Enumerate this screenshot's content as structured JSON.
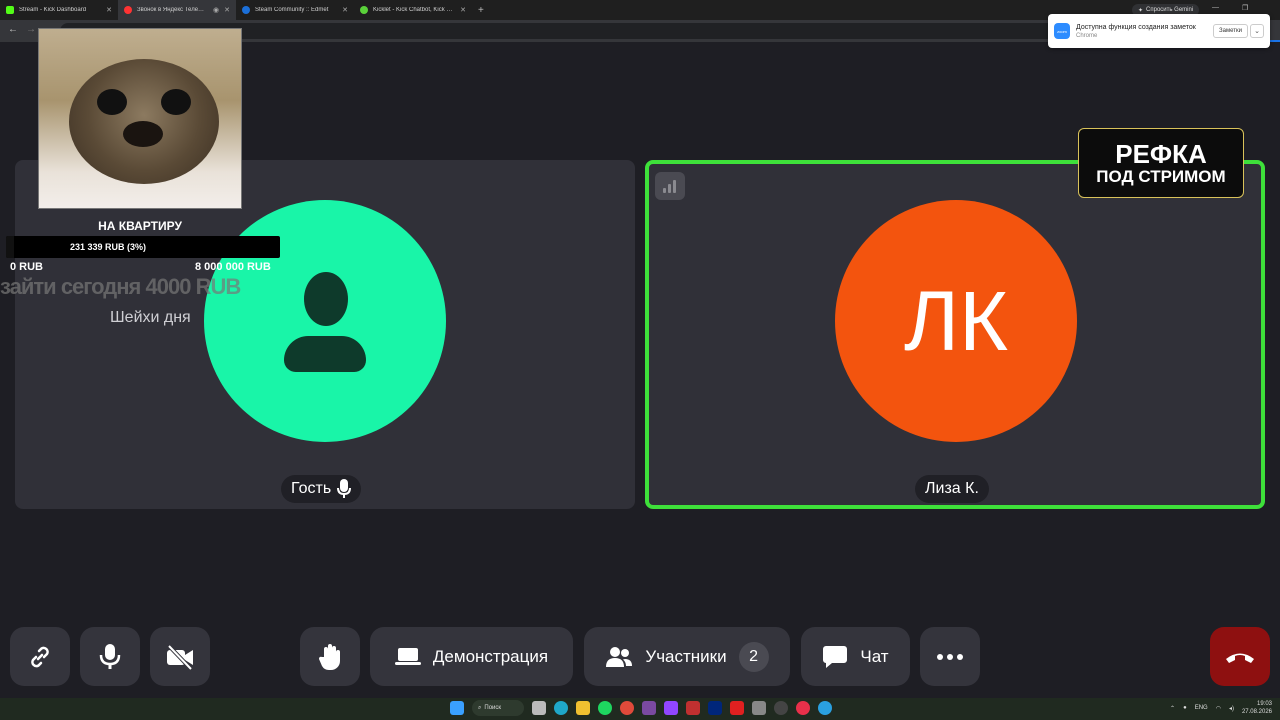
{
  "browser": {
    "tabs": [
      {
        "title": "Stream - Kick Dashboard",
        "color": "#53fc18",
        "active": false
      },
      {
        "title": "Звонок в Яндекс Телемост",
        "color": "#ff3333",
        "active": true
      },
      {
        "title": "Steam Community :: Edmet",
        "color": "#1b6fd8",
        "active": false
      },
      {
        "title": "Kicklet - Kick Chatbot, Kick Widgets",
        "color": "#5ad13a",
        "active": false
      }
    ],
    "gemini_label": "Спросить Gemini"
  },
  "notification": {
    "title": "Доступна функция создания заметок",
    "subtitle": "Chrome",
    "button": "Заметки"
  },
  "overlay": {
    "goal_title": "НА КВАРТИРУ",
    "goal_progress_text": "231 339 RUB (3%)",
    "goal_progress_pct": 3,
    "goal_min": "0 RUB",
    "goal_max": "8 000 000 RUB",
    "ghost_text": "зайти сегодня 4000 RUB",
    "top_label": "Шейхи дня",
    "refka_line1": "РЕФКА",
    "refka_line2": "ПОД СТРИМОМ"
  },
  "participants": {
    "guest": {
      "name": "Гость",
      "color": "#19f5a8"
    },
    "liza": {
      "name": "Лиза К.",
      "initials": "ЛК",
      "color": "#f3540e"
    }
  },
  "controls": {
    "demo_label": "Демонстрация",
    "participants_label": "Участники",
    "participants_count": "2",
    "chat_label": "Чат"
  },
  "taskbar": {
    "search_label": "Поиск",
    "lang": "ENG",
    "time": "19:03",
    "date": "27.08.2026"
  }
}
